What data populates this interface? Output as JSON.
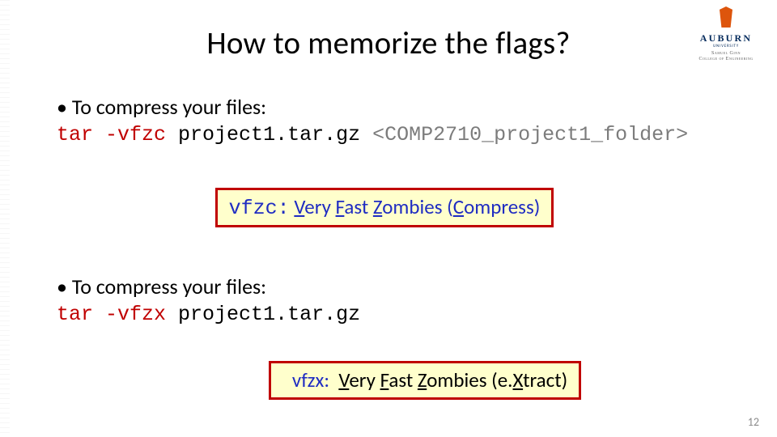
{
  "title": "How to memorize the flags?",
  "logo": {
    "university": "AUBURN",
    "sub": "UNIVERSITY",
    "college_l1": "Samuel Ginn",
    "college_l2": "College of Engineering"
  },
  "block1": {
    "bullet": "To compress your files:",
    "cmd": "tar -vfzc",
    "file": "project1.tar.gz",
    "arg": "<COMP2710_project1_folder>",
    "mnemonic_label": "vfzc:",
    "m_V": "V",
    "m_ery": "ery ",
    "m_F": "F",
    "m_ast": "ast ",
    "m_Z": "Z",
    "m_ombies": "ombies (",
    "m_C": "C",
    "m_ompress": "ompress)"
  },
  "block2": {
    "bullet": "To compress your files:",
    "cmd": "tar -vfzx",
    "file": "project1.tar.gz",
    "mnemonic_label": "vfzx:",
    "m_V": "V",
    "m_ery": "ery ",
    "m_F": "F",
    "m_ast": "ast ",
    "m_Z": "Z",
    "m_ombies": "ombies (e.",
    "m_X": "X",
    "m_tract": "tract)"
  },
  "pagenum": "12"
}
